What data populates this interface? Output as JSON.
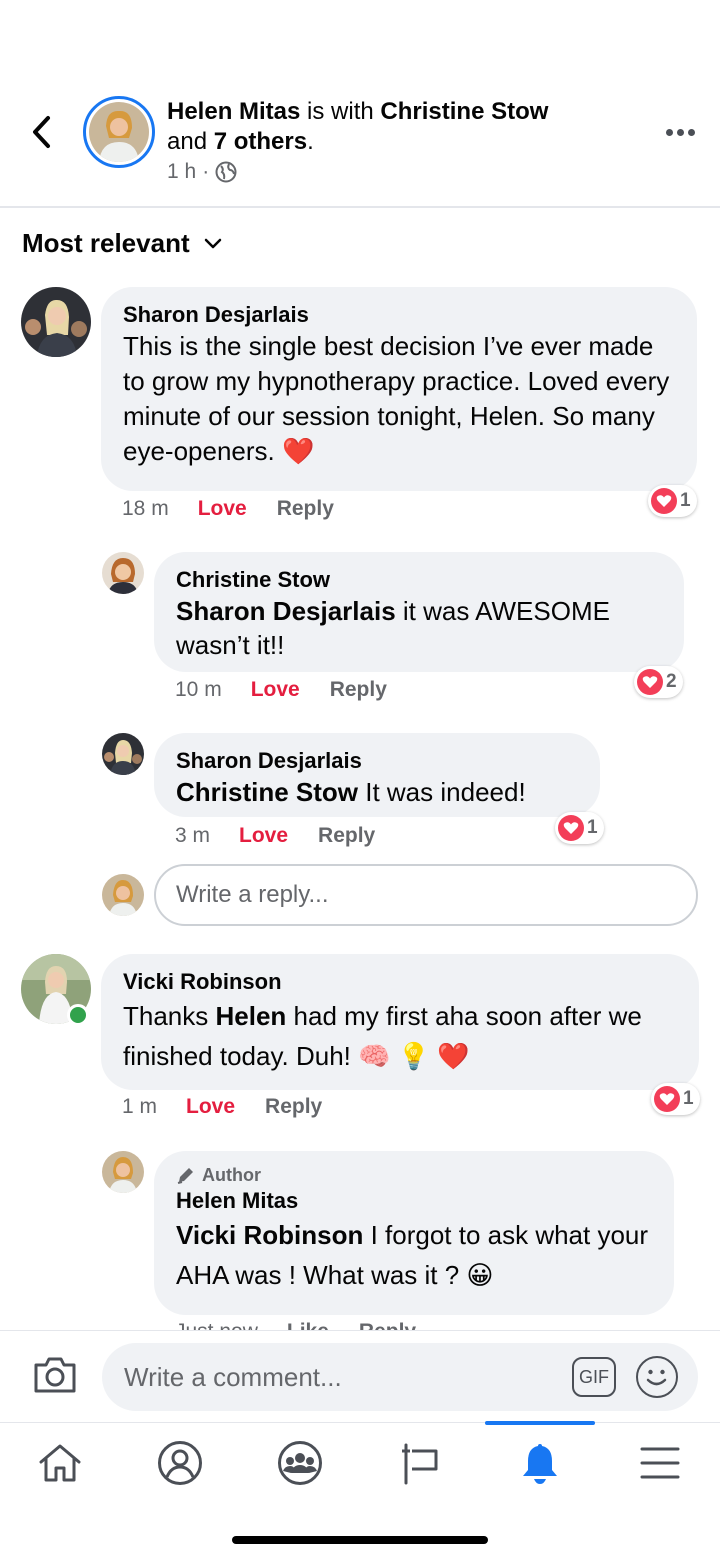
{
  "post": {
    "poster": "Helen Mitas",
    "with_text": "is with",
    "tagged": "Christine Stow",
    "and_text": "and",
    "others": "7 others",
    "period": ".",
    "time": "1 h",
    "dot": "·"
  },
  "sort": {
    "label": "Most relevant"
  },
  "comments": [
    {
      "author": "Sharon Desjarlais",
      "text": "This is the single best decision I’ve ever made to grow my hypnotherapy practice. Loved every minute of our session tonight, Helen. So many eye-openers. ❤️",
      "time": "18 m",
      "love": "Love",
      "reply": "Reply",
      "reactions": "1"
    },
    {
      "author": "Christine Stow",
      "mention": "Sharon Desjarlais",
      "text": " it was AWESOME wasn’t it!!",
      "time": "10 m",
      "love": "Love",
      "reply": "Reply",
      "reactions": "2"
    },
    {
      "author": "Sharon Desjarlais",
      "mention": "Christine Stow",
      "text": " It was indeed!",
      "time": "3 m",
      "love": "Love",
      "reply": "Reply",
      "reactions": "1"
    },
    {
      "author": "Vicki Robinson",
      "text_before": "Thanks ",
      "mention": "Helen",
      "text": " had my first aha soon after we finished today. Duh! 🧠 💡 ❤️",
      "time": "1 m",
      "love": "Love",
      "reply": "Reply",
      "reactions": "1"
    },
    {
      "badge": "Author",
      "author": "Helen Mitas",
      "mention": "Vicki Robinson",
      "text": " I forgot to ask what your AHA was ! What was it ? 😀",
      "time": "Just now",
      "like": "Like",
      "reply": "Reply"
    }
  ],
  "reply_box": {
    "placeholder": "Write a reply..."
  },
  "composer": {
    "placeholder": "Write a comment...",
    "gif": "GIF"
  },
  "tabs": [
    "home-icon",
    "profile-icon",
    "groups-icon",
    "pages-flag-icon",
    "notifications-bell-icon",
    "menu-icon"
  ],
  "colors": {
    "accent": "#1877f2",
    "love": "#e41e3f",
    "bubble": "#f0f2f5"
  }
}
